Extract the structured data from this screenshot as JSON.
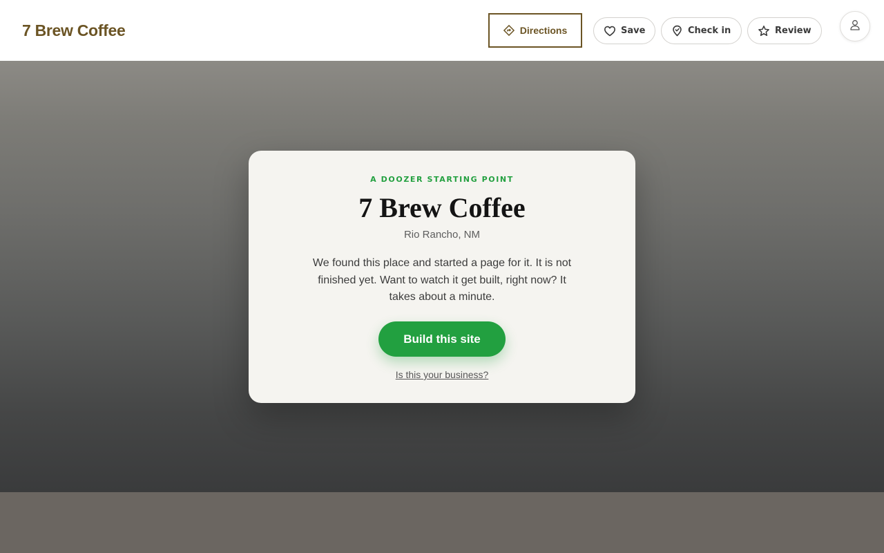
{
  "header": {
    "brand": "7 Brew Coffee",
    "directions_label": "Directions",
    "save_label": "Save",
    "checkin_label": "Check in",
    "review_label": "Review"
  },
  "card": {
    "eyebrow": "A DOOZER STARTING POINT",
    "title": "7 Brew Coffee",
    "location": "Rio Rancho, NM",
    "description": "We found this place and started a page for it. It is not finished yet. Want to watch it get built, right now? It takes about a minute.",
    "cta_label": "Build this site",
    "claim_link": "Is this your business?"
  },
  "icons": {
    "directions": "directions-icon",
    "save": "heart-icon",
    "checkin": "map-pin-icon",
    "review": "star-icon",
    "avatar": "user-icon"
  },
  "colors": {
    "brand": "#6b5424",
    "accent_green": "#22a040",
    "card_background": "#f5f4f0"
  }
}
